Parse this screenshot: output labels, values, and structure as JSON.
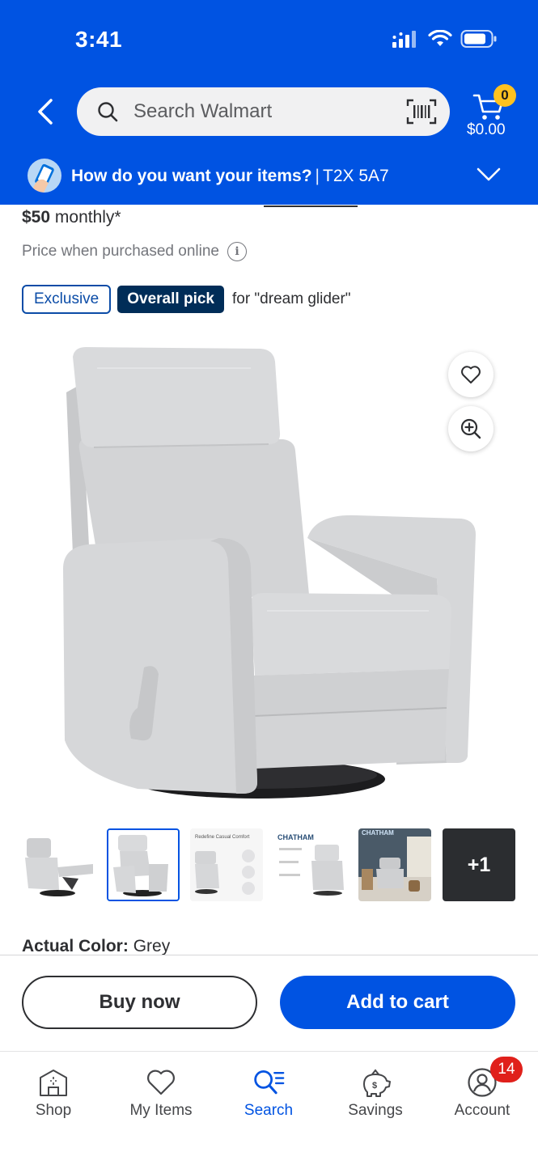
{
  "status": {
    "time": "3:41"
  },
  "header": {
    "search_placeholder": "Search Walmart",
    "cart_count": "0",
    "cart_total": "$0.00",
    "delivery_question": "How do you want your items?",
    "delivery_separator": "|",
    "delivery_zip": "T2X 5A7"
  },
  "product": {
    "monthly_amount": "$50",
    "monthly_suffix": "monthly*",
    "price_note": "Price when purchased online",
    "tag_exclusive": "Exclusive",
    "tag_pick": "Overall pick",
    "tag_for": "for \"dream glider\"",
    "image_alt": "Grey swivel glider recliner chair",
    "thumbnails": [
      {
        "kind": "reclined"
      },
      {
        "kind": "front",
        "selected": true
      },
      {
        "kind": "infographic",
        "caption": "Redefine Casual Comfort"
      },
      {
        "kind": "infographic",
        "caption": "CHATHAM"
      },
      {
        "kind": "room",
        "caption": "CHATHAM"
      },
      {
        "kind": "more",
        "label": "+1"
      }
    ],
    "color_label": "Actual Color:",
    "color_value": "Grey"
  },
  "actions": {
    "buy_now": "Buy now",
    "add_to_cart": "Add to cart"
  },
  "nav": {
    "items": [
      {
        "label": "Shop",
        "icon": "store-icon"
      },
      {
        "label": "My Items",
        "icon": "heart-icon"
      },
      {
        "label": "Search",
        "icon": "search-list-icon",
        "active": true
      },
      {
        "label": "Savings",
        "icon": "piggy-bank-icon"
      },
      {
        "label": "Account",
        "icon": "account-icon"
      }
    ],
    "account_badge": "14"
  },
  "colors": {
    "brand_blue": "#0053e2",
    "spark_yellow": "#ffc220",
    "badge_red": "#e0201b",
    "navy": "#002d58"
  }
}
